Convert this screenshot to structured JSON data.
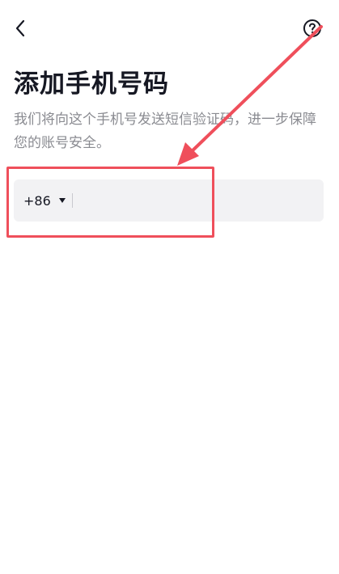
{
  "header": {
    "back_icon": "chevron-left-icon",
    "help_icon": "question-circle-icon"
  },
  "page": {
    "title": "添加手机号码",
    "subtitle": "我们将向这个手机号发送短信验证码，进一步保障您的账号安全。"
  },
  "phone_form": {
    "country_code": "+86",
    "caret_icon": "caret-down-icon",
    "phone_value": "",
    "phone_placeholder": ""
  },
  "annotation": {
    "color": "#ef4f5b"
  }
}
